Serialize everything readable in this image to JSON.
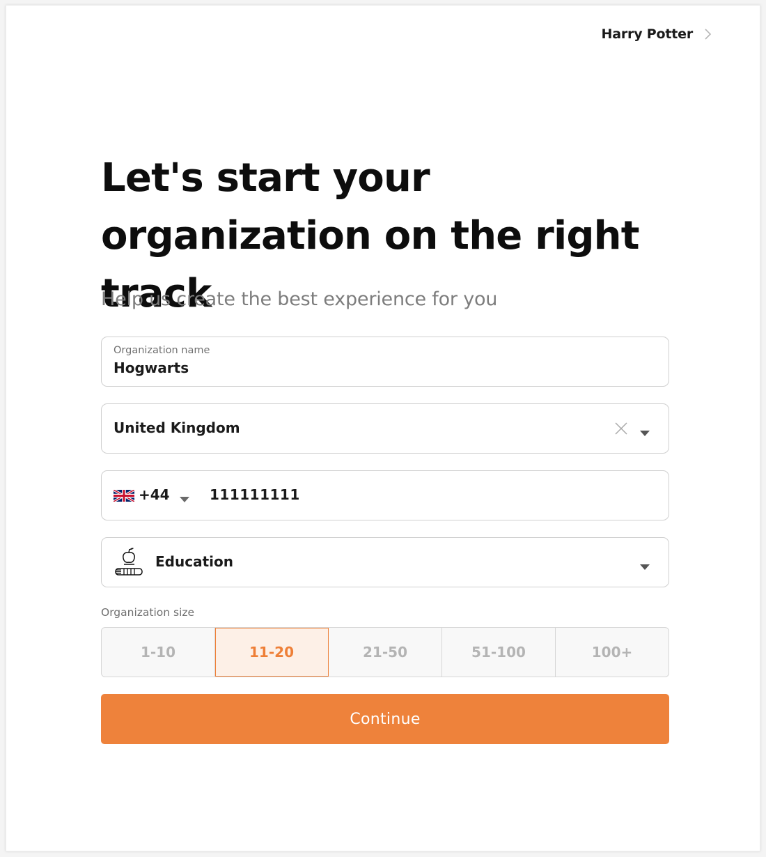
{
  "header": {
    "user_name": "Harry Potter",
    "user_menu_icon": "chevron-right-icon"
  },
  "main": {
    "title": "Let's start your organization on the right track",
    "subtitle": "Help us create the best experience for you"
  },
  "form": {
    "organization_name": {
      "label": "Organization name",
      "value": "Hogwarts"
    },
    "country": {
      "value": "United Kingdom",
      "clear_icon": "close-icon",
      "dropdown_icon": "caret-down-icon"
    },
    "phone": {
      "flag_icon": "uk-flag-icon",
      "dial_code": "+44",
      "number": "111111111"
    },
    "industry": {
      "icon": "education-icon",
      "value": "Education"
    },
    "organization_size": {
      "label": "Organization size",
      "options": [
        "1-10",
        "11-20",
        "21-50",
        "51-100",
        "100+"
      ],
      "selected": "11-20"
    },
    "submit_label": "Continue"
  },
  "colors": {
    "accent": "#ee823b",
    "selected_bg": "#fdf0e7",
    "text_primary": "#1a1a1a",
    "text_muted": "#7d7d7d",
    "border": "#cfcfcf"
  }
}
